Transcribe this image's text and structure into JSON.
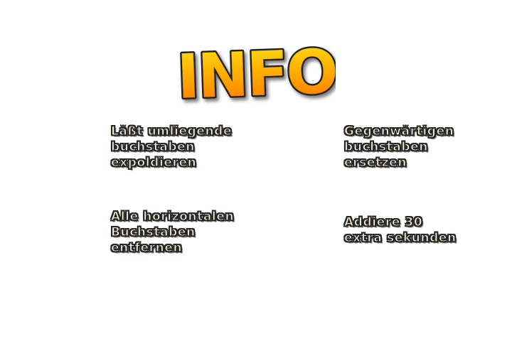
{
  "title": "INFO",
  "colors": {
    "title_top": "#ffe21a",
    "title_mid": "#ffb000",
    "title_bottom": "#ff7000",
    "title_outline": "#222222",
    "text_fill": "#fdf4df",
    "text_outline": "#222222"
  },
  "items": [
    {
      "text": "Läßt umliegende\nbuchstaben\nexpoldieren"
    },
    {
      "text": "Gegenwärtigen\nbuchstaben\nersetzen"
    },
    {
      "text": "Alle horizontalen\nBuchstaben\nentfernen"
    },
    {
      "text": "Addiere 30\nextra sekunden"
    }
  ]
}
